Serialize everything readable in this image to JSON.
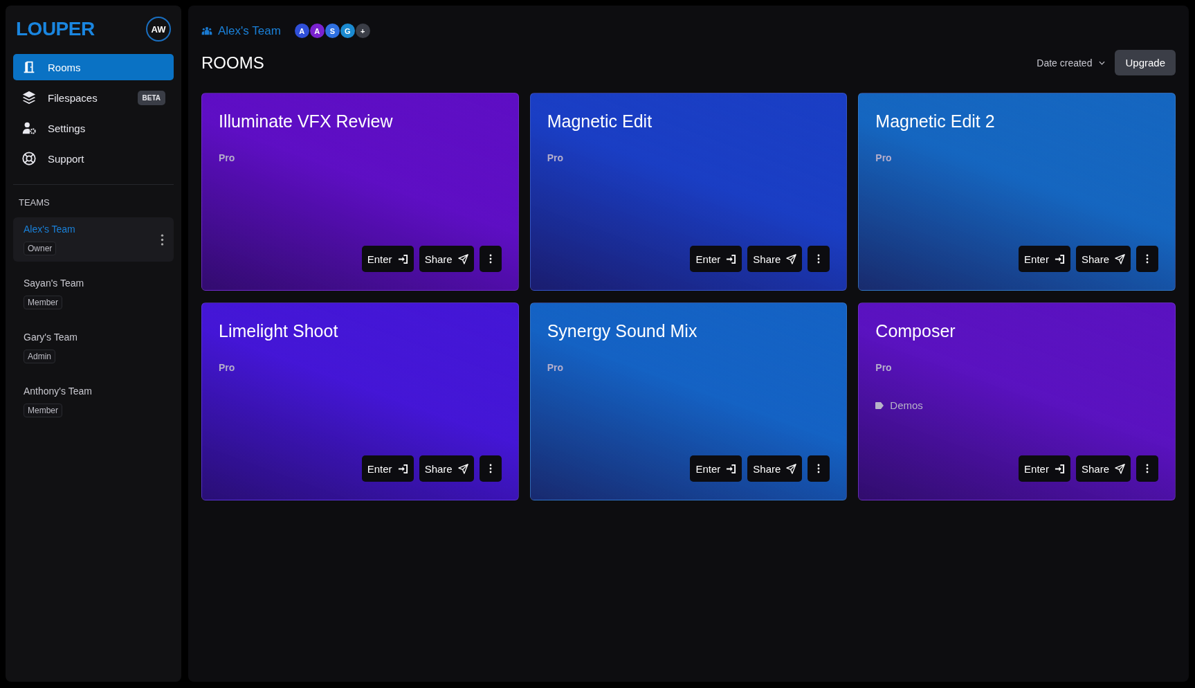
{
  "sidebar": {
    "logo": "LOUPER",
    "user_avatar": "AW",
    "nav": [
      {
        "label": "Rooms",
        "selected": true
      },
      {
        "label": "Filespaces",
        "selected": false,
        "badge": "BETA"
      },
      {
        "label": "Settings",
        "selected": false
      },
      {
        "label": "Support",
        "selected": false
      }
    ],
    "teams_heading": "TEAMS",
    "teams": [
      {
        "name": "Alex's Team",
        "role": "Owner",
        "selected": true
      },
      {
        "name": "Sayan's Team",
        "role": "Member",
        "selected": false
      },
      {
        "name": "Gary's Team",
        "role": "Admin",
        "selected": false
      },
      {
        "name": "Anthony's Team",
        "role": "Member",
        "selected": false
      }
    ]
  },
  "header": {
    "team": "Alex's Team",
    "members": [
      {
        "initial": "A",
        "color": "#2f4fd8"
      },
      {
        "initial": "A",
        "color": "#7a22d0"
      },
      {
        "initial": "S",
        "color": "#2e6fe0"
      },
      {
        "initial": "G",
        "color": "#1b8ad0"
      }
    ],
    "add_member": "+",
    "title": "ROOMS",
    "sort": "Date created",
    "upgrade": "Upgrade"
  },
  "rooms": [
    {
      "name": "Illuminate VFX Review",
      "plan": "Pro",
      "color": "#5e0ec4",
      "enter": "Enter",
      "share": "Share"
    },
    {
      "name": "Magnetic Edit",
      "plan": "Pro",
      "color": "#1a3ec4",
      "enter": "Enter",
      "share": "Share"
    },
    {
      "name": "Magnetic Edit 2",
      "plan": "Pro",
      "color": "#1566c0",
      "enter": "Enter",
      "share": "Share"
    },
    {
      "name": "Limelight Shoot",
      "plan": "Pro",
      "color": "#4416d6",
      "enter": "Enter",
      "share": "Share"
    },
    {
      "name": "Synergy Sound Mix",
      "plan": "Pro",
      "color": "#1462c4",
      "enter": "Enter",
      "share": "Share"
    },
    {
      "name": "Composer",
      "plan": "Pro",
      "color": "#5a12c0",
      "tags": [
        "Demos"
      ],
      "enter": "Enter",
      "share": "Share"
    }
  ]
}
